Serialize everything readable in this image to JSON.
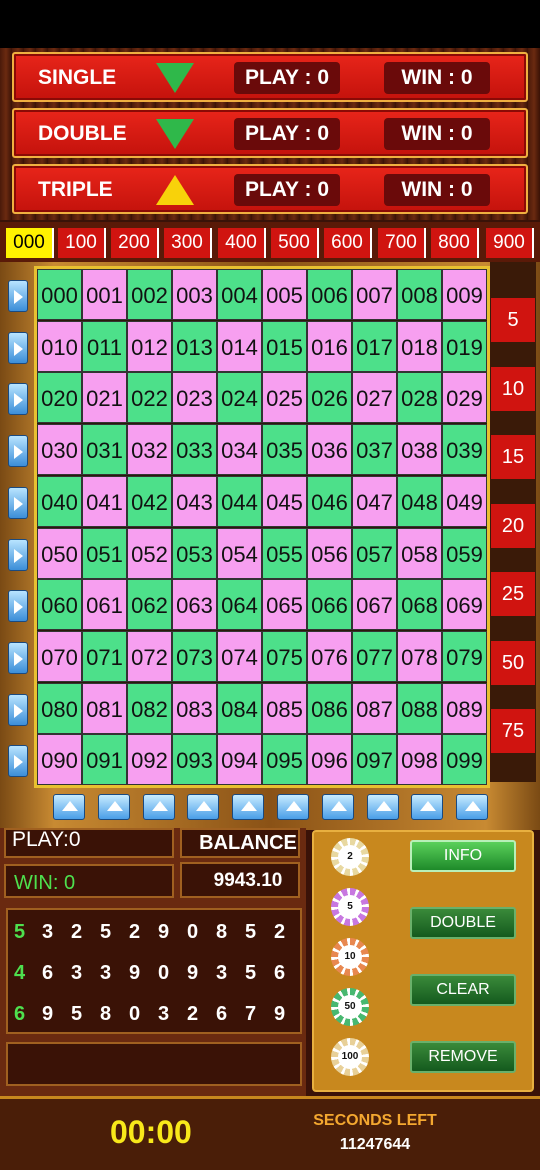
{
  "bet_types": [
    {
      "label": "SINGLE",
      "arrow": "down",
      "play": "PLAY : 0",
      "win": "WIN : 0"
    },
    {
      "label": "DOUBLE",
      "arrow": "down",
      "play": "PLAY : 0",
      "win": "WIN : 0"
    },
    {
      "label": "TRIPLE",
      "arrow": "up",
      "play": "PLAY : 0",
      "win": "WIN : 0"
    }
  ],
  "hundreds": [
    "000",
    "100",
    "200",
    "300",
    "400",
    "500",
    "600",
    "700",
    "800",
    "900"
  ],
  "active_hundred": "000",
  "grid_numbers": [
    [
      "000",
      "001",
      "002",
      "003",
      "004",
      "005",
      "006",
      "007",
      "008",
      "009"
    ],
    [
      "010",
      "011",
      "012",
      "013",
      "014",
      "015",
      "016",
      "017",
      "018",
      "019"
    ],
    [
      "020",
      "021",
      "022",
      "023",
      "024",
      "025",
      "026",
      "027",
      "028",
      "029"
    ],
    [
      "030",
      "031",
      "032",
      "033",
      "034",
      "035",
      "036",
      "037",
      "038",
      "039"
    ],
    [
      "040",
      "041",
      "042",
      "043",
      "044",
      "045",
      "046",
      "047",
      "048",
      "049"
    ],
    [
      "050",
      "051",
      "052",
      "053",
      "054",
      "055",
      "056",
      "057",
      "058",
      "059"
    ],
    [
      "060",
      "061",
      "062",
      "063",
      "064",
      "065",
      "066",
      "067",
      "068",
      "069"
    ],
    [
      "070",
      "071",
      "072",
      "073",
      "074",
      "075",
      "076",
      "077",
      "078",
      "079"
    ],
    [
      "080",
      "081",
      "082",
      "083",
      "084",
      "085",
      "086",
      "087",
      "088",
      "089"
    ],
    [
      "090",
      "091",
      "092",
      "093",
      "094",
      "095",
      "096",
      "097",
      "098",
      "099"
    ]
  ],
  "multipliers": [
    "5",
    "10",
    "15",
    "20",
    "25",
    "50",
    "75"
  ],
  "stats": {
    "play": "PLAY:0",
    "win": "WIN: 0",
    "balance_label": "BALANCE",
    "balance_value": "9943.10"
  },
  "history": [
    [
      "5",
      "3",
      "2",
      "5",
      "2",
      "9",
      "0",
      "8",
      "5",
      "2"
    ],
    [
      "4",
      "6",
      "3",
      "3",
      "9",
      "0",
      "9",
      "3",
      "5",
      "6"
    ],
    [
      "6",
      "9",
      "5",
      "8",
      "0",
      "3",
      "2",
      "6",
      "7",
      "9"
    ]
  ],
  "chips": [
    "2",
    "5",
    "10",
    "50",
    "100"
  ],
  "chip_colors": [
    "#e8d8a0",
    "#c878e0",
    "#e88850",
    "#48b870",
    "#e8d098"
  ],
  "buttons": {
    "info": "INFO",
    "double": "DOUBLE",
    "clear": "CLEAR",
    "remove": "REMOVE"
  },
  "timer": "00:00",
  "seconds_left_label": "SECONDS LEFT",
  "seconds_left_value": "11247644"
}
